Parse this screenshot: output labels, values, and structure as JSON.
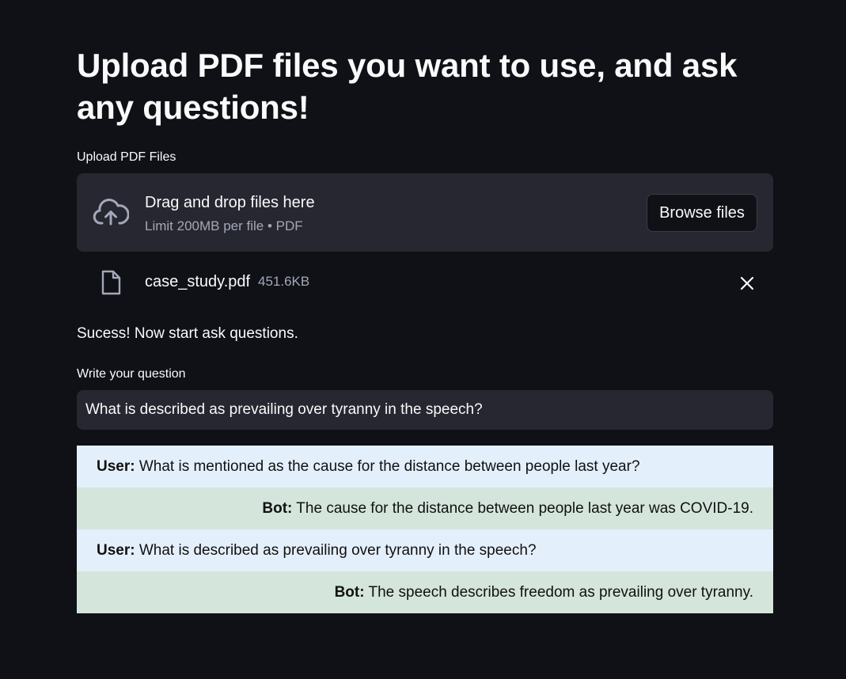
{
  "page": {
    "title": "Upload PDF files you want to use, and ask any questions!"
  },
  "uploader": {
    "label": "Upload PDF Files",
    "drag_text": "Drag and drop files here",
    "limit_text": "Limit 200MB per file • PDF",
    "browse_label": "Browse files",
    "icon": "cloud-upload-icon"
  },
  "uploaded_file": {
    "name": "case_study.pdf",
    "size": "451.6KB",
    "icon": "file-icon",
    "remove_icon": "close-icon"
  },
  "status": {
    "success_text": "Sucess! Now start ask questions."
  },
  "question": {
    "label": "Write your question",
    "value": "What is described as prevailing over tyranny in the speech?"
  },
  "chat": {
    "messages": [
      {
        "role": "user",
        "speaker": "User:",
        "text": " What is mentioned as the cause for the distance between people last year?"
      },
      {
        "role": "bot",
        "speaker": "Bot:",
        "text": " The cause for the distance between people last year was COVID-19."
      },
      {
        "role": "user",
        "speaker": "User:",
        "text": " What is described as prevailing over tyranny in the speech?"
      },
      {
        "role": "bot",
        "speaker": "Bot:",
        "text": " The speech describes freedom as prevailing over tyranny."
      }
    ]
  },
  "colors": {
    "background": "#0f1117",
    "surface": "#262730",
    "user_bubble": "#e4effc",
    "bot_bubble": "#d4e5dc",
    "muted_text": "#a3a8b8"
  }
}
